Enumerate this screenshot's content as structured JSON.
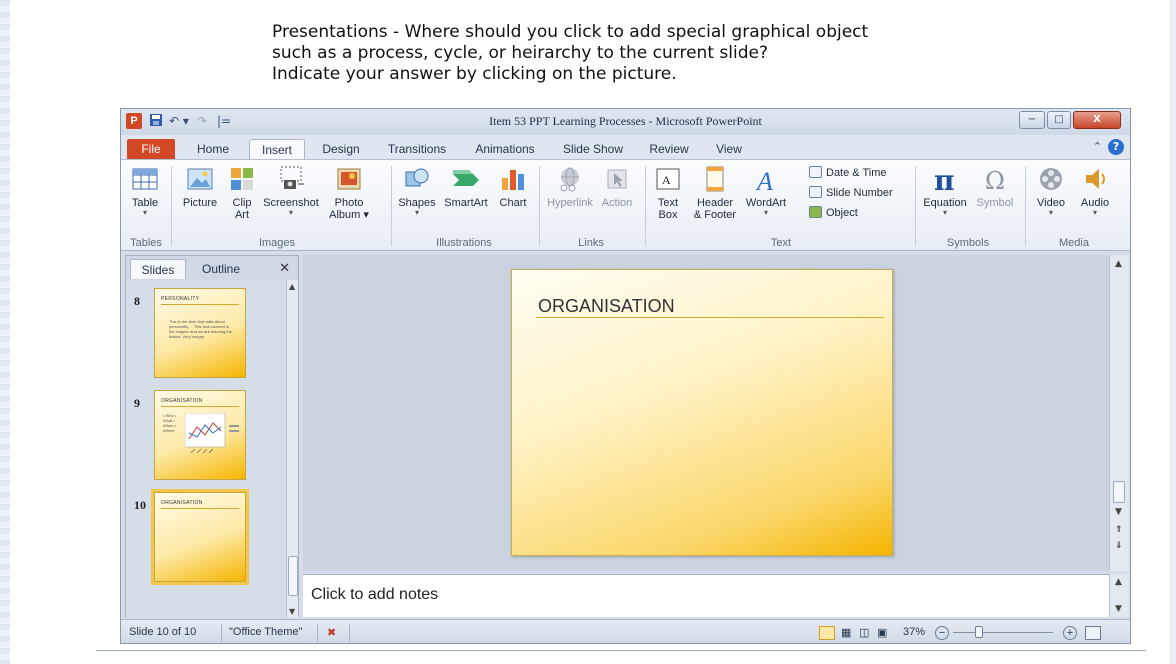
{
  "question": {
    "line1": "Presentations - Where should you click to add special graphical object",
    "line2": "such as a process, cycle, or heirarchy to the current slide?",
    "line3": "Indicate your answer by clicking on the picture."
  },
  "window": {
    "title": "Item 53 PPT Learning Processes - Microsoft PowerPoint",
    "app_icon_letter": "P",
    "qa_undo": "↶ ▾",
    "qa_redo": "↷",
    "qa_customize": "|=",
    "minimize": "−",
    "maximize": "□",
    "close": "X"
  },
  "tabs": [
    "File",
    "Home",
    "Insert",
    "Design",
    "Transitions",
    "Animations",
    "Slide Show",
    "Review",
    "View"
  ],
  "ribbon": {
    "tables": {
      "group": "Tables",
      "table": "Table"
    },
    "images": {
      "group": "Images",
      "picture": "Picture",
      "clipart_1": "Clip",
      "clipart_2": "Art",
      "screenshot": "Screenshot",
      "photo_1": "Photo",
      "photo_2": "Album ▾"
    },
    "illustrations": {
      "group": "Illustrations",
      "shapes": "Shapes",
      "smartart": "SmartArt",
      "chart": "Chart"
    },
    "links": {
      "group": "Links",
      "hyperlink": "Hyperlink",
      "action": "Action"
    },
    "text": {
      "group": "Text",
      "textbox_1": "Text",
      "textbox_2": "Box",
      "header_1": "Header",
      "header_2": "& Footer",
      "wordart": "WordArt",
      "date_time": "Date & Time",
      "slide_number": "Slide Number",
      "object": "Object"
    },
    "symbols": {
      "group": "Symbols",
      "equation": "Equation",
      "symbol": "Symbol"
    },
    "media": {
      "group": "Media",
      "video": "Video",
      "audio": "Audio"
    }
  },
  "left_pane": {
    "tabs": [
      "Slides",
      "Outline"
    ],
    "close": "✕",
    "slides": [
      {
        "number": "8",
        "title": "PERSONALITY",
        "body": "This is the slide that talks about personality ... This was covered in the chapter and we are learning the basics. Very hungry."
      },
      {
        "number": "9",
        "title": "ORGANISATION",
        "body": "• Who • What • When • Where"
      },
      {
        "number": "10",
        "title": "ORGANISATION",
        "body": ""
      }
    ]
  },
  "slide": {
    "title": "ORGANISATION"
  },
  "notes": {
    "placeholder": "Click to add notes"
  },
  "status": {
    "slide_info": "Slide 10 of 10",
    "theme": "\"Office Theme\"",
    "zoom": "37%",
    "zoom_out": "−",
    "zoom_in": "+"
  },
  "colors": {
    "file_tab": "#d24726",
    "slide_gradient_end": "#f4b400",
    "accent_blue": "#2a6fd0"
  }
}
